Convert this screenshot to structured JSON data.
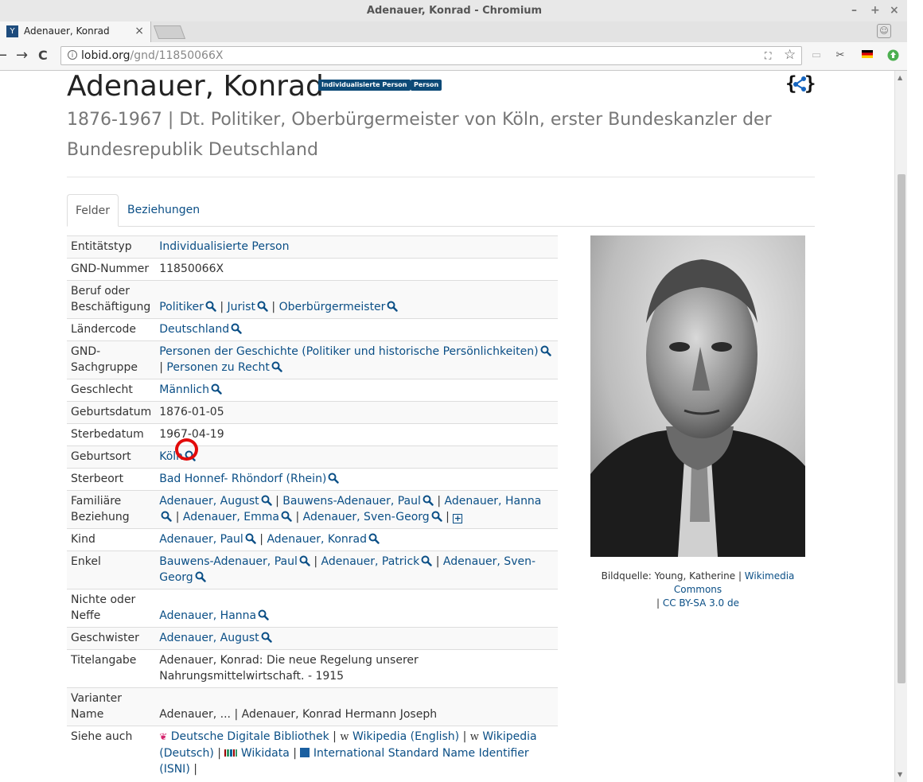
{
  "window": {
    "title": "Adenauer, Konrad - Chromium",
    "controls": [
      "–",
      "+",
      "×"
    ]
  },
  "tab": {
    "title": "Adenauer, Konrad",
    "close": "×"
  },
  "toolbar": {
    "back": "←",
    "forward": "→",
    "reload": "C",
    "url_host": "lobid.org",
    "url_path": "/gnd/11850066X",
    "bookmark": "☆"
  },
  "entity": {
    "name": "Adenauer, Konrad",
    "badges": [
      "Individualisierte Person",
      "Person"
    ],
    "json_icon": "{<}",
    "subtitle": "1876-1967 | Dt. Politiker, Oberbürgermeister von Köln, erster Bundeskanzler der Bundesrepublik Deutschland"
  },
  "tabs": {
    "felder": "Felder",
    "beziehungen": "Beziehungen"
  },
  "fields": {
    "entitaetstyp": {
      "label": "Entitätstyp",
      "values": [
        "Individualisierte Person"
      ]
    },
    "gnd_nummer": {
      "label": "GND-Nummer",
      "value": "11850066X"
    },
    "beruf": {
      "label": "Beruf oder Beschäftigung",
      "values": [
        "Politiker",
        "Jurist",
        "Oberbürgermeister"
      ]
    },
    "laendercode": {
      "label": "Ländercode",
      "values": [
        "Deutschland"
      ]
    },
    "sachgruppe": {
      "label": "GND-Sachgruppe",
      "values": [
        "Personen der Geschichte (Politiker und historische Persönlichkeiten)",
        "Personen zu Recht"
      ]
    },
    "geschlecht": {
      "label": "Geschlecht",
      "values": [
        "Männlich"
      ]
    },
    "geburtsdatum": {
      "label": "Geburtsdatum",
      "value": "1876-01-05"
    },
    "sterbedatum": {
      "label": "Sterbedatum",
      "value": "1967-04-19"
    },
    "geburtsort": {
      "label": "Geburtsort",
      "values": [
        "Köln"
      ]
    },
    "sterbeort": {
      "label": "Sterbeort",
      "values": [
        "Bad Honnef- Rhöndorf (Rhein)"
      ]
    },
    "familiaere": {
      "label": "Familiäre Beziehung",
      "values": [
        "Adenauer, August",
        "Bauwens-Adenauer, Paul",
        "Adenauer, Hanna",
        "Adenauer, Emma",
        "Adenauer, Sven-Georg"
      ]
    },
    "kind": {
      "label": "Kind",
      "values": [
        "Adenauer, Paul",
        "Adenauer, Konrad"
      ]
    },
    "enkel": {
      "label": "Enkel",
      "values": [
        "Bauwens-Adenauer, Paul",
        "Adenauer, Patrick",
        "Adenauer, Sven-Georg"
      ]
    },
    "nichte": {
      "label": "Nichte oder Neffe",
      "values": [
        "Adenauer, Hanna"
      ]
    },
    "geschwister": {
      "label": "Geschwister",
      "values": [
        "Adenauer, August"
      ]
    },
    "titelangabe": {
      "label": "Titelangabe",
      "value": "Adenauer, Konrad: Die neue Regelung unserer Nahrungsmittelwirtschaft. - 1915"
    },
    "variante": {
      "label": "Varianter Name",
      "value": "Adenauer, ... | Adenauer, Konrad Hermann Joseph"
    },
    "siehe_auch": {
      "label": "Siehe auch",
      "values": [
        "Deutsche Digitale Bibliothek",
        "Wikipedia (English)",
        "Wikipedia (Deutsch)",
        "Wikidata",
        "International Standard Name Identifier (ISNI)"
      ]
    }
  },
  "caption": {
    "prefix": "Bildquelle: Young, Katherine",
    "wikimedia": "Wikimedia Commons",
    "license": "CC BY-SA 3.0 de"
  },
  "colors": {
    "link": "#0b4f86",
    "badge": "#0d4a77",
    "highlight": "#e20b0b"
  },
  "icons": [
    "search-icon",
    "expand-plus-icon",
    "json-ld-icon",
    "info-icon",
    "star-icon"
  ]
}
